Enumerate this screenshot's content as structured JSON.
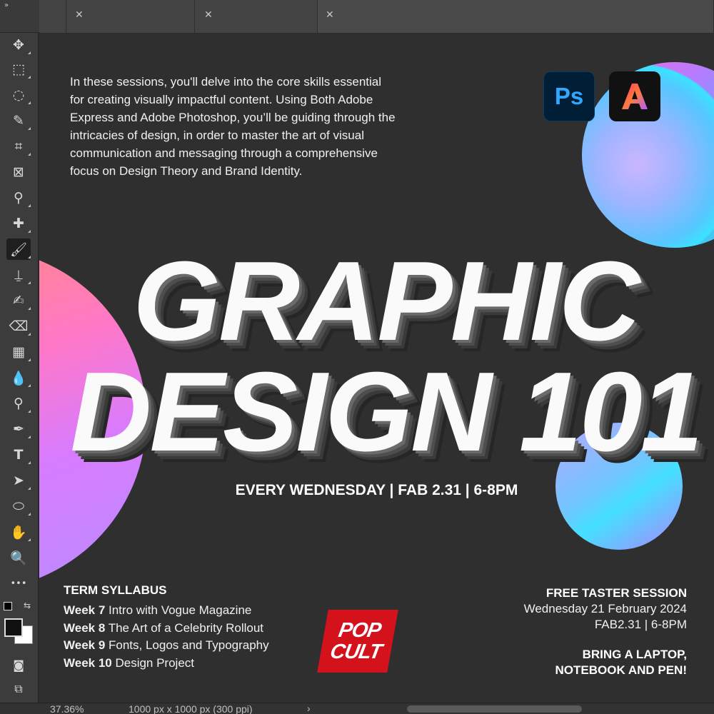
{
  "panel_collapse": "»",
  "tabs": [
    {
      "close": "✕"
    },
    {
      "close": "✕"
    },
    {
      "close": "✕"
    }
  ],
  "toolbar": {
    "tools": [
      {
        "icon": "move-icon",
        "glyph": "✥"
      },
      {
        "icon": "marquee-icon",
        "glyph": "⬚"
      },
      {
        "icon": "lasso-icon",
        "glyph": "◌"
      },
      {
        "icon": "quick-select-icon",
        "glyph": "✎"
      },
      {
        "icon": "crop-icon",
        "glyph": "⌗"
      },
      {
        "icon": "frame-icon",
        "glyph": "⊠"
      },
      {
        "icon": "eyedropper-icon",
        "glyph": "⚲"
      },
      {
        "icon": "healing-brush-icon",
        "glyph": "✚"
      },
      {
        "icon": "brush-icon",
        "glyph": "🖌"
      },
      {
        "icon": "clone-stamp-icon",
        "glyph": "⍊"
      },
      {
        "icon": "history-brush-icon",
        "glyph": "✍"
      },
      {
        "icon": "eraser-icon",
        "glyph": "⌫"
      },
      {
        "icon": "gradient-icon",
        "glyph": "▦"
      },
      {
        "icon": "blur-icon",
        "glyph": "💧"
      },
      {
        "icon": "dodge-icon",
        "glyph": "⚲"
      },
      {
        "icon": "pen-icon",
        "glyph": "✒"
      },
      {
        "icon": "type-icon",
        "glyph": "T"
      },
      {
        "icon": "path-select-icon",
        "glyph": "➤"
      },
      {
        "icon": "ellipse-icon",
        "glyph": "⬭"
      },
      {
        "icon": "hand-icon",
        "glyph": "✋"
      },
      {
        "icon": "zoom-icon",
        "glyph": "🔍"
      },
      {
        "icon": "more-tools-icon",
        "glyph": "•••"
      }
    ],
    "active_tool": "brush-icon"
  },
  "poster": {
    "intro": "In these sessions, you'll delve into the core skills essential for creating visually impactful content. Using Both Adobe Express and Adobe Photoshop, you’ll be guiding through the intricacies of design, in order to master the art of visual communication and messaging through a comprehensive focus on Design Theory and Brand Identity.",
    "ps_icon_label": "Ps",
    "express_icon": "adobe-express-icon",
    "headline_line1": "GRAPHIC",
    "headline_line2": "DESIGN 101",
    "schedule": "EVERY WEDNESDAY | FAB 2.31 | 6-8PM",
    "syllabus": {
      "title": "TERM SYLLABUS",
      "weeks": [
        {
          "week": "Week 7",
          "topic": " Intro with Vogue Magazine"
        },
        {
          "week": "Week 8",
          "topic": " The Art of a Celebrity Rollout"
        },
        {
          "week": "Week 9",
          "topic": " Fonts, Logos and Typography"
        },
        {
          "week": "Week 10",
          "topic": " Design Project"
        }
      ]
    },
    "logo": {
      "line1": "POP",
      "line2": "CULT",
      "color": "#d4121b"
    },
    "taster": {
      "title": "FREE TASTER SESSION",
      "date": "Wednesday 21 February 2024",
      "place_time": "FAB2.31 | 6-8PM",
      "bring_line1": "BRING A LAPTOP,",
      "bring_line2": "NOTEBOOK AND PEN!"
    }
  },
  "statusbar": {
    "zoom": "37.36%",
    "dimensions": "1000 px x 1000 px (300 ppi)",
    "chevron": "›"
  }
}
